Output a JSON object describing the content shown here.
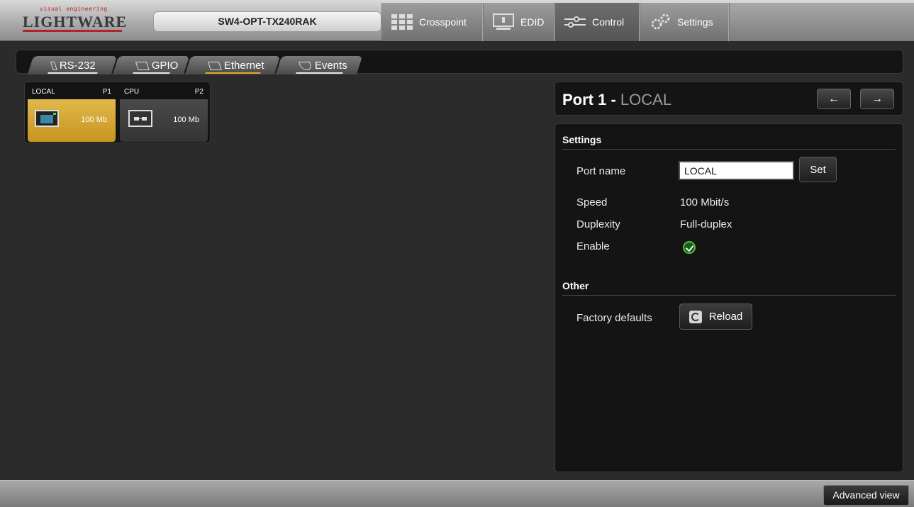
{
  "header": {
    "logo_tagline": "visual engineering",
    "logo_text": "LIGHTWARE",
    "device_name": "SW4-OPT-TX240RAK",
    "tabs": [
      {
        "label": "Crosspoint",
        "icon": "crosspoint-grid-icon"
      },
      {
        "label": "EDID",
        "icon": "monitor-icon"
      },
      {
        "label": "Control",
        "icon": "sliders-icon",
        "active": true
      },
      {
        "label": "Settings",
        "icon": "gears-icon"
      }
    ]
  },
  "subtabs": [
    {
      "label": "RS-232",
      "icon": "serial-port-icon"
    },
    {
      "label": "GPIO",
      "icon": "gpio-connector-icon"
    },
    {
      "label": "Ethernet",
      "icon": "ethernet-icon",
      "active": true
    },
    {
      "label": "Events",
      "icon": "events-icon"
    }
  ],
  "ports": [
    {
      "name": "LOCAL",
      "id": "P1",
      "speed": "100 Mb",
      "selected": true
    },
    {
      "name": "CPU",
      "id": "P2",
      "speed": "100 Mb",
      "selected": false
    }
  ],
  "detail": {
    "title_prefix": "Port 1",
    "title_sep": " - ",
    "title_name": "LOCAL",
    "prev_label": "←",
    "next_label": "→",
    "settings_header": "Settings",
    "port_name_label": "Port name",
    "port_name_value": "LOCAL",
    "set_label": "Set",
    "speed_label": "Speed",
    "speed_value": "100 Mbit/s",
    "duplexity_label": "Duplexity",
    "duplexity_value": "Full-duplex",
    "enable_label": "Enable",
    "enable_value": true,
    "other_header": "Other",
    "factory_label": "Factory defaults",
    "reload_label": "Reload"
  },
  "footer": {
    "advanced_label": "Advanced view"
  },
  "colors": {
    "accent": "#e0a72a",
    "selected_port": "#d4a638",
    "panel_bg": "#141414",
    "page_bg": "#2b2b2b",
    "enable_green": "#4bbd39"
  }
}
